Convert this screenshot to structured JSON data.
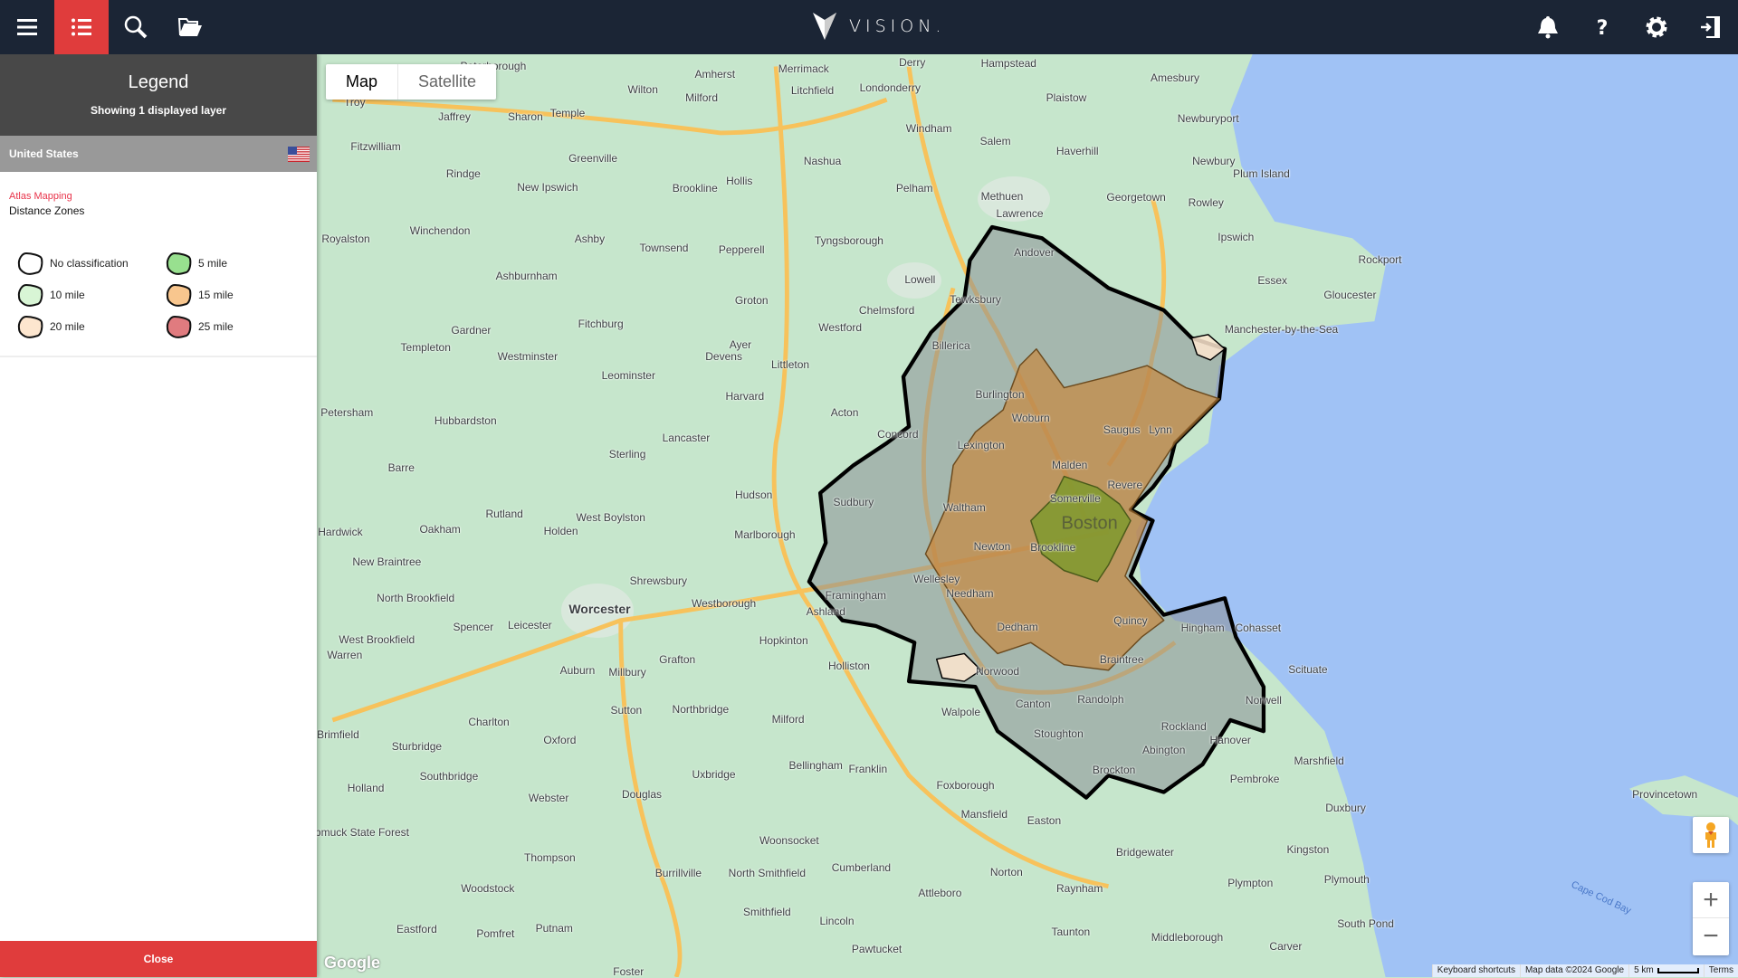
{
  "app": {
    "name": "VISION."
  },
  "topbar": {
    "left_icons": [
      "menu-icon",
      "list-icon",
      "search-icon",
      "folder-open-icon"
    ],
    "right_icons": [
      "bell-icon",
      "help-icon",
      "gear-icon",
      "logout-icon"
    ],
    "active": "list-icon",
    "accent": "#e03c3c",
    "bg": "#1b2535"
  },
  "legend": {
    "title": "Legend",
    "subtitle": "Showing 1 displayed layer",
    "country": "United States",
    "layer_source": "Atlas Mapping",
    "layer_name": "Distance Zones",
    "items": [
      {
        "label": "No classification",
        "color": "#ffffff"
      },
      {
        "label": "5 mile",
        "color": "#98e08f"
      },
      {
        "label": "10 mile",
        "color": "#d8f5d5"
      },
      {
        "label": "15 mile",
        "color": "#f8c68e"
      },
      {
        "label": "20 mile",
        "color": "#fde6cf"
      },
      {
        "label": "25 mile",
        "color": "#e07b7f"
      }
    ],
    "close_label": "Close"
  },
  "map": {
    "type_buttons": [
      "Map",
      "Satellite"
    ],
    "active_type": "Map",
    "zoom_in": "+",
    "zoom_out": "−",
    "attribution": {
      "shortcuts": "Keyboard shortcuts",
      "data": "Map data ©2024 Google",
      "scale": "5 km",
      "terms": "Terms"
    },
    "google": "Google",
    "water_label": "Cape Cod Bay",
    "labels": [
      "Wilton",
      "Amherst",
      "Merrimack",
      "Milford",
      "Litchfield",
      "Londonderry",
      "Derry",
      "Hampstead",
      "Amesbury",
      "Plaistow",
      "Newburyport",
      "Salem",
      "Windham",
      "Haverhill",
      "Nashua",
      "Hollis",
      "Pelham",
      "Methuen",
      "Lawrence",
      "Georgetown",
      "Newbury",
      "Rowley",
      "Plum Island",
      "Ipswich",
      "Rockport",
      "Essex",
      "Gloucester",
      "Manchester-by-the-Sea",
      "Andover",
      "Tewksbury",
      "Lowell",
      "Chelmsford",
      "Westford",
      "Billerica",
      "Burlington",
      "Woburn",
      "Lexington",
      "Saugus",
      "Lynn",
      "Malden",
      "Revere",
      "Somerville",
      "Boston",
      "Waltham",
      "Newton",
      "Brookline",
      "Wellesley",
      "Needham",
      "Dedham",
      "Quincy",
      "Braintree",
      "Norwood",
      "Canton",
      "Randolph",
      "Framingham",
      "Ashland",
      "Sudbury",
      "Concord",
      "Acton",
      "Hudson",
      "Marlborough",
      "Worcester",
      "Shrewsbury",
      "Westborough",
      "Hopkinton",
      "Holliston",
      "Milford",
      "Franklin",
      "Bellingham",
      "Foxborough",
      "Mansfield",
      "Walpole",
      "Stoughton",
      "Brockton",
      "Abington",
      "Rockland",
      "Hingham",
      "Cohasset",
      "Scituate",
      "Norwell",
      "Hanover",
      "Marshfield",
      "Pembroke",
      "Duxbury",
      "Kingston",
      "Plymouth",
      "Plympton",
      "Carver",
      "South Pond",
      "Provincetown",
      "Easton",
      "Bridgewater",
      "Norton",
      "Raynham",
      "Taunton",
      "Middleborough",
      "Attleboro",
      "Cumberland",
      "Woonsocket",
      "North Smithfield",
      "Smithfield",
      "Lincoln",
      "Pawtucket",
      "Uxbridge",
      "Northbridge",
      "Grafton",
      "Millbury",
      "Sutton",
      "Auburn",
      "Oxford",
      "Charlton",
      "Leicester",
      "Spencer",
      "Holden",
      "West Boylston",
      "Sterling",
      "Lancaster",
      "Harvard",
      "Leominster",
      "Fitchburg",
      "Ayer",
      "Devens",
      "Littleton",
      "Groton",
      "Pepperell",
      "Townsend",
      "Tyngsborough",
      "Ashby",
      "Ashburnham",
      "Winchendon",
      "Gardner",
      "Westminster",
      "Templeton",
      "Royalston",
      "Rindge",
      "Fitzwilliam",
      "Jaffrey",
      "Sharon",
      "Temple",
      "Troy",
      "Greenville",
      "New Ipswich",
      "Brookline",
      "Hubbardston",
      "Petersham",
      "Barre",
      "Rutland",
      "Oakham",
      "Hardwick",
      "New Braintree",
      "North Brookfield",
      "West Brookfield",
      "Warren",
      "Sturbridge",
      "Southbridge",
      "Brimfield",
      "Holland",
      "Webster",
      "Douglas",
      "Thompson",
      "Burrillville",
      "Woodstock",
      "Putnam",
      "Eastford",
      "Pomfret",
      "Nipmuck State Forest",
      "Foster",
      "Peterborough"
    ],
    "colors": {
      "land": "#c6e6cc",
      "water": "#a0c2f5",
      "road": "#f7c25b",
      "zone_outer": "#8a8f96",
      "zone_15": "#c8883f",
      "zone_5": "#7a9a2a",
      "zone_20": "#fde6cf"
    }
  }
}
